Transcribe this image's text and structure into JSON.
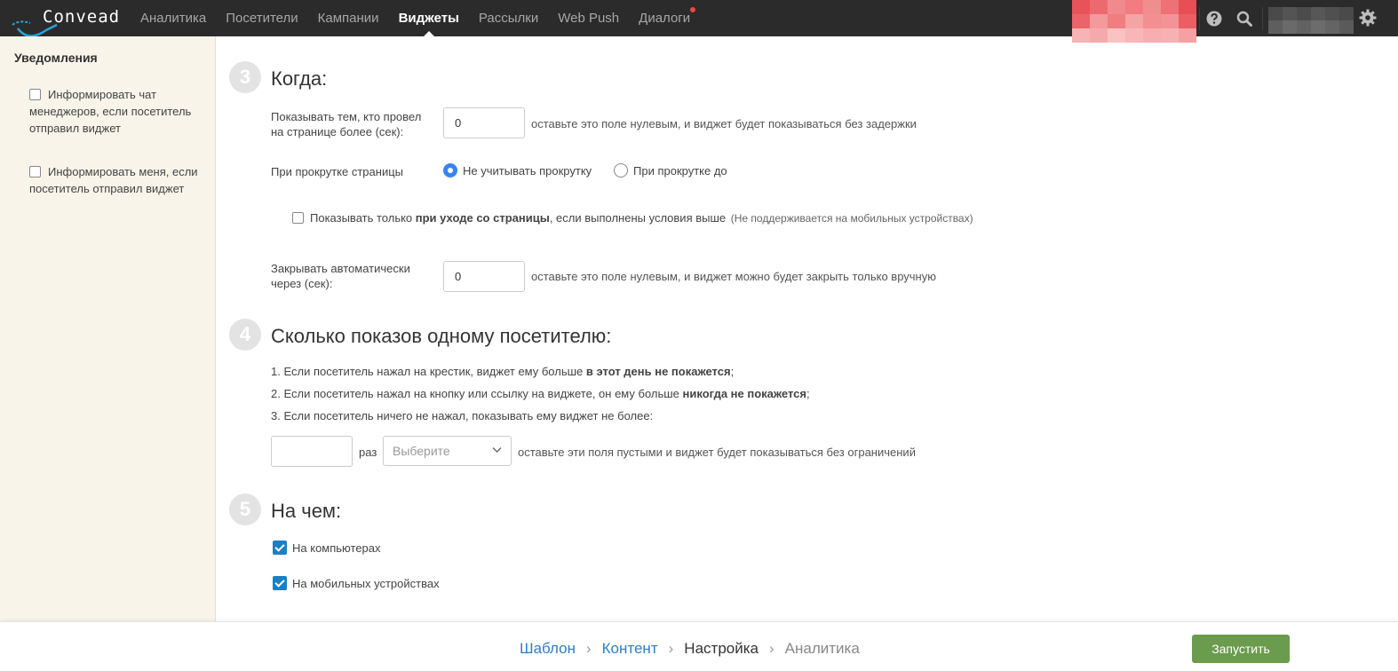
{
  "brand": {
    "name": "Convead"
  },
  "nav": {
    "items": [
      {
        "label": "Аналитика",
        "active": false
      },
      {
        "label": "Посетители",
        "active": false
      },
      {
        "label": "Кампании",
        "active": false
      },
      {
        "label": "Виджеты",
        "active": true
      },
      {
        "label": "Рассылки",
        "active": false
      },
      {
        "label": "Web Push",
        "active": false
      },
      {
        "label": "Диалоги",
        "active": false,
        "badge": true
      }
    ],
    "icons": [
      "help-icon",
      "search-icon",
      "gear-icon"
    ],
    "badge_color": "#e74c3c"
  },
  "sidebar": {
    "title": "Уведомления",
    "options": [
      {
        "label": "Информировать чат менеджеров, если посетитель отправил виджет",
        "checked": false
      },
      {
        "label": "Информировать меня, если посетитель отправил виджет",
        "checked": false
      }
    ]
  },
  "section3": {
    "num": "3",
    "title": "Когда:",
    "delay": {
      "label": "Показывать тем, кто провел на странице более (сек):",
      "value": "0",
      "hint": "оставьте это поле нулевым, и виджет будет показываться без задержки"
    },
    "scroll": {
      "label": "При прокрутке страницы",
      "options": [
        {
          "label": "Не учитывать прокрутку",
          "selected": true
        },
        {
          "label": "При прокрутке до",
          "selected": false
        }
      ]
    },
    "exit_intent": {
      "prefix": "Показывать только ",
      "bold": "при уходе со страницы",
      "suffix": ", если выполнены условия выше",
      "note": "(Не поддерживается на мобильных устройствах)",
      "checked": false
    },
    "autoclose": {
      "label": "Закрывать автоматически через (сек):",
      "value": "0",
      "hint": "оставьте это поле нулевым, и виджет можно будет закрыть только вручную"
    }
  },
  "section4": {
    "num": "4",
    "title": "Сколько показов одному посетителю:",
    "rules": [
      {
        "text": "1. Если посетитель нажал на крестик, виджет ему больше ",
        "bold": "в этот день не покажется",
        "end": ";"
      },
      {
        "text": "2. Если посетитель нажал на кнопку или ссылку на виджете, он ему больше ",
        "bold": "никогда не покажется",
        "end": ";"
      },
      {
        "text": "3. Если посетитель ничего не нажал, показывать ему виджет не более:",
        "bold": "",
        "end": ""
      }
    ],
    "times_value": "",
    "times_unit": "раз",
    "period_placeholder": "Выберите",
    "hint": "оставьте эти поля пустыми и виджет будет показываться без ограничений"
  },
  "section5": {
    "num": "5",
    "title": "На чем:",
    "devices": [
      {
        "label": "На компьютерах",
        "checked": true
      },
      {
        "label": "На мобильных устройствах",
        "checked": true
      }
    ]
  },
  "wizard": {
    "steps": [
      {
        "label": "Шаблон",
        "state": "link"
      },
      {
        "label": "Контент",
        "state": "link"
      },
      {
        "label": "Настройка",
        "state": "current"
      },
      {
        "label": "Аналитика",
        "state": "disabled"
      }
    ],
    "launch_label": "Запустить",
    "launch_color": "#6b9b4d"
  }
}
